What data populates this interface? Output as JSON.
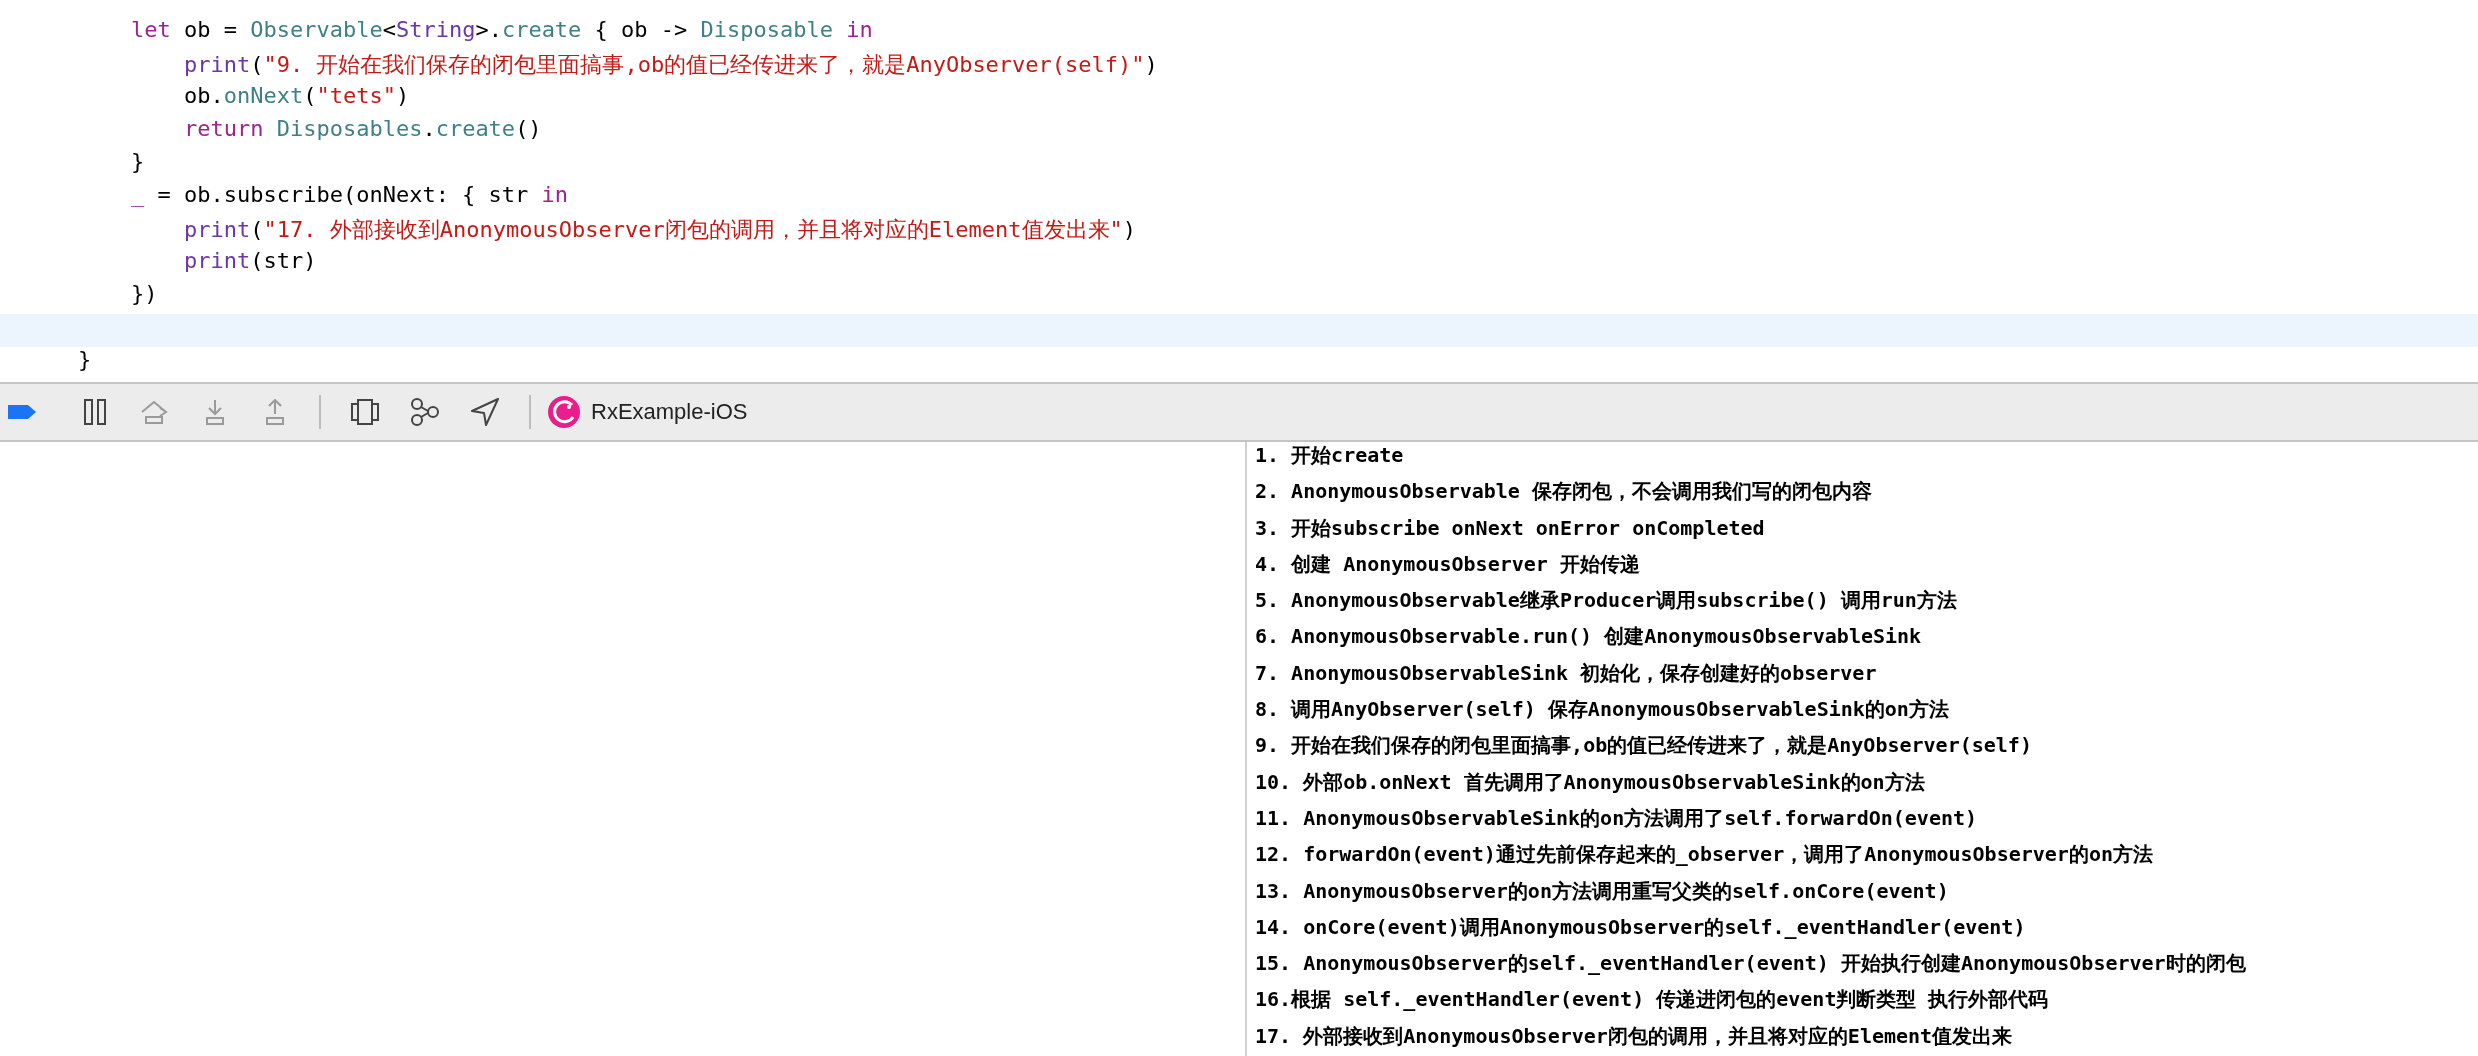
{
  "editor": {
    "lines": [
      {
        "highlighted": false,
        "tokens": [
          {
            "kind": "keyword",
            "text": "    let"
          },
          {
            "kind": "plain",
            "text": " ob = "
          },
          {
            "kind": "type",
            "text": "Observable"
          },
          {
            "kind": "plain",
            "text": "<"
          },
          {
            "kind": "lib",
            "text": "String"
          },
          {
            "kind": "plain",
            "text": ">."
          },
          {
            "kind": "type",
            "text": "create"
          },
          {
            "kind": "plain",
            "text": " { ob -> "
          },
          {
            "kind": "type",
            "text": "Disposable"
          },
          {
            "kind": "keyword",
            "text": " in"
          }
        ]
      },
      {
        "highlighted": false,
        "tokens": [
          {
            "kind": "lib",
            "text": "        print"
          },
          {
            "kind": "plain",
            "text": "("
          },
          {
            "kind": "string",
            "text": "\"9. 开始在我们保存的闭包里面搞事,ob的值已经传进来了，就是AnyObserver(self)\""
          },
          {
            "kind": "plain",
            "text": ")"
          }
        ]
      },
      {
        "highlighted": false,
        "tokens": [
          {
            "kind": "plain",
            "text": "        ob."
          },
          {
            "kind": "type",
            "text": "onNext"
          },
          {
            "kind": "plain",
            "text": "("
          },
          {
            "kind": "string",
            "text": "\"tets\""
          },
          {
            "kind": "plain",
            "text": ")"
          }
        ]
      },
      {
        "highlighted": false,
        "tokens": [
          {
            "kind": "keyword",
            "text": "        return"
          },
          {
            "kind": "type",
            "text": " Disposables"
          },
          {
            "kind": "plain",
            "text": "."
          },
          {
            "kind": "type",
            "text": "create"
          },
          {
            "kind": "plain",
            "text": "()"
          }
        ]
      },
      {
        "highlighted": false,
        "tokens": [
          {
            "kind": "plain",
            "text": "    }"
          }
        ]
      },
      {
        "highlighted": false,
        "tokens": [
          {
            "kind": "keyword",
            "text": "    _"
          },
          {
            "kind": "plain",
            "text": " = ob.subscribe(onNext: { str "
          },
          {
            "kind": "keyword",
            "text": "in"
          }
        ]
      },
      {
        "highlighted": false,
        "tokens": [
          {
            "kind": "lib",
            "text": "        print"
          },
          {
            "kind": "plain",
            "text": "("
          },
          {
            "kind": "string",
            "text": "\"17. 外部接收到AnonymousObserver闭包的调用，并且将对应的Element值发出来\""
          },
          {
            "kind": "plain",
            "text": ")"
          }
        ]
      },
      {
        "highlighted": false,
        "tokens": [
          {
            "kind": "lib",
            "text": "        print"
          },
          {
            "kind": "plain",
            "text": "(str)"
          }
        ]
      },
      {
        "highlighted": false,
        "tokens": [
          {
            "kind": "plain",
            "text": "    })"
          }
        ]
      },
      {
        "highlighted": true
      },
      {
        "highlighted": false,
        "tokens": [
          {
            "kind": "plain",
            "text": "}"
          }
        ]
      }
    ]
  },
  "debug_bar": {
    "buttons": [
      {
        "kind": "breakpoints",
        "disabled": false
      },
      {
        "kind": "pause",
        "disabled": false
      },
      {
        "kind": "step-over",
        "disabled": true
      },
      {
        "kind": "step-into",
        "disabled": true
      },
      {
        "kind": "step-out",
        "disabled": true
      },
      {
        "kind": "separator"
      },
      {
        "kind": "view-debugger",
        "disabled": false
      },
      {
        "kind": "memory-graph",
        "disabled": false
      },
      {
        "kind": "location",
        "disabled": false
      },
      {
        "kind": "separator"
      }
    ],
    "scheme": "RxExample-iOS"
  },
  "console": {
    "lines": [
      "1. 开始create",
      "2. AnonymousObservable 保存闭包，不会调用我们写的闭包内容",
      "3. 开始subscribe onNext onError onCompleted",
      "4. 创建 AnonymousObserver 开始传递",
      "5. AnonymousObservable继承Producer调用subscribe() 调用run方法",
      "6. AnonymousObservable.run() 创建AnonymousObservableSink",
      "7. AnonymousObservableSink 初始化，保存创建好的observer",
      "8. 调用AnyObserver(self) 保存AnonymousObservableSink的on方法",
      "9. 开始在我们保存的闭包里面搞事,ob的值已经传进来了，就是AnyObserver(self)",
      "10. 外部ob.onNext 首先调用了AnonymousObservableSink的on方法",
      "11. AnonymousObservableSink的on方法调用了self.forwardOn(event)",
      "12. forwardOn(event)通过先前保存起来的_observer，调用了AnonymousObserver的on方法",
      "13. AnonymousObserver的on方法调用重写父类的self.onCore(event)",
      "14. onCore(event)调用AnonymousObserver的self._eventHandler(event)",
      "15. AnonymousObserver的self._eventHandler(event) 开始执行创建AnonymousObserver时的闭包",
      "16.根据 self._eventHandler(event) 传递进闭包的event判断类型 执行外部代码",
      "17. 外部接收到AnonymousObserver闭包的调用，并且将对应的Element值发出来"
    ]
  }
}
